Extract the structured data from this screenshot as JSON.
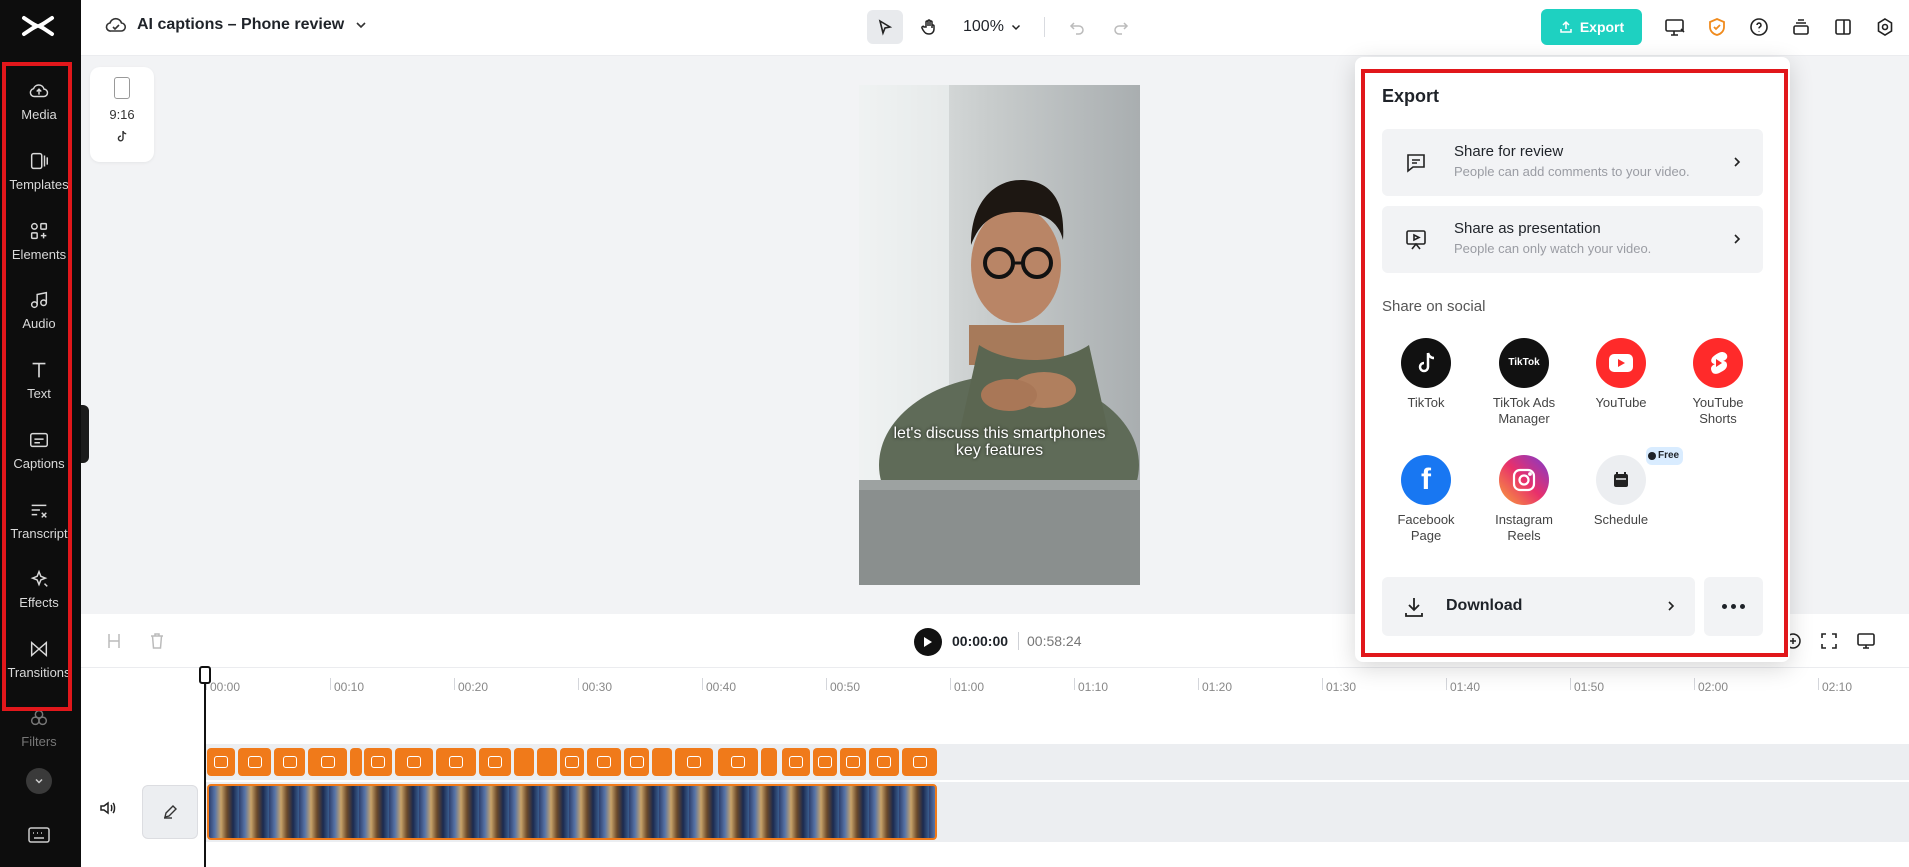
{
  "project": {
    "title": "AI captions – Phone review"
  },
  "toolbar": {
    "zoom": "100%",
    "export_label": "Export"
  },
  "sidebar": {
    "items": [
      {
        "label": "Media",
        "icon": "cloud-upload-icon"
      },
      {
        "label": "Templates",
        "icon": "templates-icon"
      },
      {
        "label": "Elements",
        "icon": "elements-icon"
      },
      {
        "label": "Audio",
        "icon": "music-note-icon"
      },
      {
        "label": "Text",
        "icon": "text-icon"
      },
      {
        "label": "Captions",
        "icon": "captions-icon"
      },
      {
        "label": "Transcript",
        "icon": "transcript-icon"
      },
      {
        "label": "Effects",
        "icon": "effects-icon"
      },
      {
        "label": "Transitions",
        "icon": "transitions-icon"
      },
      {
        "label": "Filters",
        "icon": "filters-icon"
      }
    ]
  },
  "canvas": {
    "ratio": "9:16",
    "caption": "let's discuss this smartphones key features"
  },
  "player": {
    "current": "00:00:00",
    "total": "00:58:24"
  },
  "timeline": {
    "ticks": [
      "00:00",
      "00:10",
      "00:20",
      "00:30",
      "00:40",
      "00:50",
      "01:00",
      "01:10",
      "01:20",
      "01:30",
      "01:40",
      "01:50",
      "02:00",
      "02:10"
    ]
  },
  "export_panel": {
    "title": "Export",
    "share_review": {
      "title": "Share for review",
      "desc": "People can add comments to your video."
    },
    "share_presentation": {
      "title": "Share as presentation",
      "desc": "People can only watch your video."
    },
    "social_heading": "Share on social",
    "social": [
      {
        "label": "TikTok",
        "color": "#111111"
      },
      {
        "label": "TikTok Ads Manager",
        "color": "#111111",
        "logo_text": "TikTok"
      },
      {
        "label": "YouTube",
        "color": "#ff2a2a"
      },
      {
        "label": "YouTube Shorts",
        "color": "#ff2a2a"
      },
      {
        "label": "Facebook Page",
        "color": "#1877f2"
      },
      {
        "label": "Instagram Reels",
        "color": "#d6246e"
      },
      {
        "label": "Schedule",
        "color": "#eceef1",
        "badge": "Free"
      }
    ],
    "download_label": "Download"
  },
  "colors": {
    "accent": "#1ed1c1",
    "caption_clip": "#f07a1a",
    "highlight": "#e1171b"
  }
}
